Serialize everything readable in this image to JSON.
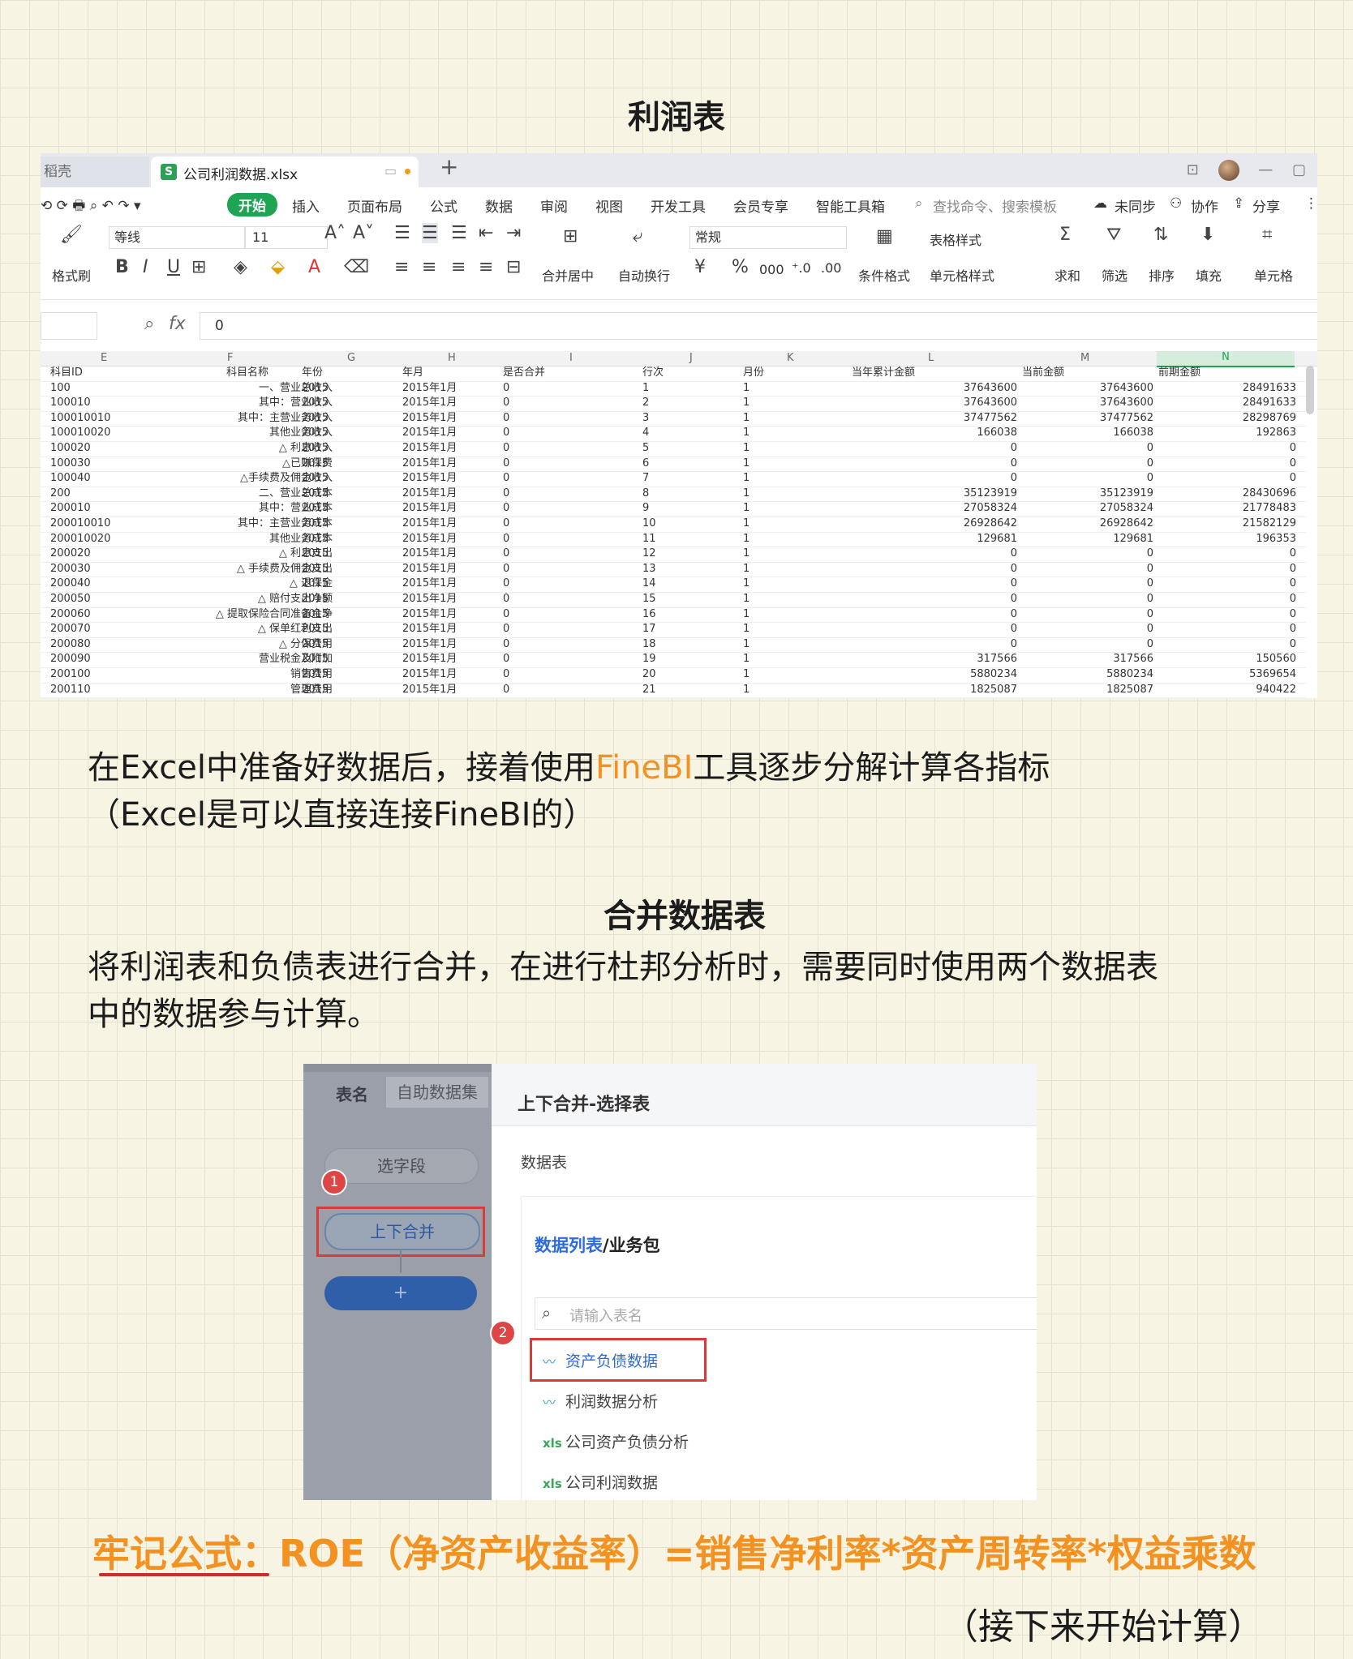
{
  "title1": "利润表",
  "excel": {
    "tab_inactive": "稻壳",
    "tab_file_icon": "S",
    "tab_active": "公司利润数据.xlsx",
    "tab_plus": "+",
    "menu": {
      "start": "开始",
      "items": [
        "插入",
        "页面布局",
        "公式",
        "数据",
        "审阅",
        "视图",
        "开发工具",
        "会员专享",
        "智能工具箱"
      ],
      "search": "查找命令、搜索模板",
      "unsync": "未同步",
      "collab": "协作",
      "share": "分享"
    },
    "ribbon": {
      "format_painter": "格式刷",
      "font_name": "等线",
      "font_size": "11",
      "merge_center": "合并居中",
      "wrap_text": "自动换行",
      "number_format": "常规",
      "cond_format": "条件格式",
      "table_style": "表格样式",
      "cell_style": "单元格样式",
      "sum": "求和",
      "filter": "筛选",
      "sort": "排序",
      "fill": "填充",
      "cell": "单元格"
    },
    "formula_bar": {
      "fx": "fx",
      "value": "0"
    },
    "col_letters": [
      "E",
      "F",
      "G",
      "H",
      "I",
      "J",
      "K",
      "L",
      "M",
      "N"
    ],
    "table": {
      "headers": [
        "科目ID",
        "科目名称",
        "年份",
        "年月",
        "是否合并",
        "行次",
        "月份",
        "当年累计金额",
        "当前金额",
        "前期金额"
      ],
      "rows": [
        [
          "100",
          "一、营业总收入",
          "2015",
          "2015年1月",
          "0",
          "1",
          "1",
          "37643600",
          "37643600",
          "28491633"
        ],
        [
          "100010",
          "其中：营业收入",
          "2015",
          "2015年1月",
          "0",
          "2",
          "1",
          "37643600",
          "37643600",
          "28491633"
        ],
        [
          "100010010",
          "其中：主营业务收入",
          "2015",
          "2015年1月",
          "0",
          "3",
          "1",
          "37477562",
          "37477562",
          "28298769"
        ],
        [
          "100010020",
          "其他业务收入",
          "2015",
          "2015年1月",
          "0",
          "4",
          "1",
          "166038",
          "166038",
          "192863"
        ],
        [
          "100020",
          "△ 利息收入",
          "2015",
          "2015年1月",
          "0",
          "5",
          "1",
          "0",
          "0",
          "0"
        ],
        [
          "100030",
          "△已赚保费",
          "2015",
          "2015年1月",
          "0",
          "6",
          "1",
          "0",
          "0",
          "0"
        ],
        [
          "100040",
          "△手续费及佣金收入",
          "2015",
          "2015年1月",
          "0",
          "7",
          "1",
          "0",
          "0",
          "0"
        ],
        [
          "200",
          "二、营业总成本",
          "2015",
          "2015年1月",
          "0",
          "8",
          "1",
          "35123919",
          "35123919",
          "28430696"
        ],
        [
          "200010",
          "其中：营业成本",
          "2015",
          "2015年1月",
          "0",
          "9",
          "1",
          "27058324",
          "27058324",
          "21778483"
        ],
        [
          "200010010",
          "其中：主营业务成本",
          "2015",
          "2015年1月",
          "0",
          "10",
          "1",
          "26928642",
          "26928642",
          "21582129"
        ],
        [
          "200010020",
          "其他业务成本",
          "2015",
          "2015年1月",
          "0",
          "11",
          "1",
          "129681",
          "129681",
          "196353"
        ],
        [
          "200020",
          "△ 利息支出",
          "2015",
          "2015年1月",
          "0",
          "12",
          "1",
          "0",
          "0",
          "0"
        ],
        [
          "200030",
          "△ 手续费及佣金支出",
          "2015",
          "2015年1月",
          "0",
          "13",
          "1",
          "0",
          "0",
          "0"
        ],
        [
          "200040",
          "△ 退保金",
          "2015",
          "2015年1月",
          "0",
          "14",
          "1",
          "0",
          "0",
          "0"
        ],
        [
          "200050",
          "△ 赔付支出净额",
          "2015",
          "2015年1月",
          "0",
          "15",
          "1",
          "0",
          "0",
          "0"
        ],
        [
          "200060",
          "△ 提取保险合同准备金净",
          "2015",
          "2015年1月",
          "0",
          "16",
          "1",
          "0",
          "0",
          "0"
        ],
        [
          "200070",
          "△ 保单红利支出",
          "2015",
          "2015年1月",
          "0",
          "17",
          "1",
          "0",
          "0",
          "0"
        ],
        [
          "200080",
          "△ 分保费用",
          "2015",
          "2015年1月",
          "0",
          "18",
          "1",
          "0",
          "0",
          "0"
        ],
        [
          "200090",
          "营业税金及附加",
          "2015",
          "2015年1月",
          "0",
          "19",
          "1",
          "317566",
          "317566",
          "150560"
        ],
        [
          "200100",
          "销售费用",
          "2015",
          "2015年1月",
          "0",
          "20",
          "1",
          "5880234",
          "5880234",
          "5369654"
        ],
        [
          "200110",
          "管理费用",
          "2015",
          "2015年1月",
          "0",
          "21",
          "1",
          "1825087",
          "1825087",
          "940422"
        ]
      ]
    }
  },
  "para1": {
    "before": "在Excel中准备好数据后，接着使用",
    "highlight": "FineBI",
    "after": "工具逐步分解计算各指标"
  },
  "para2": "（Excel是可以直接连接FineBI的）",
  "title2": "合并数据表",
  "para3": "将利润表和负债表进行合并，在进行杜邦分析时，需要同时使用两个数据表",
  "para4": "中的数据参与计算。",
  "bi": {
    "tab_name": "表名",
    "tab_dataset": "自助数据集",
    "select_field": "选字段",
    "merge_updown": "上下合并",
    "add": "+",
    "badge1": "1",
    "badge2": "2",
    "panel_title": "上下合并-选择表",
    "data_table_label": "数据表",
    "breadcrumb_link": "数据列表",
    "breadcrumb_rest": "/业务包",
    "search_placeholder": "请输入表名",
    "items": [
      {
        "icon": "chart",
        "label": "资产负债数据"
      },
      {
        "icon": "chart",
        "label": "利润数据分析"
      },
      {
        "icon": "xls",
        "label": "公司资产负债分析"
      },
      {
        "icon": "xls",
        "label": "公司利润数据"
      }
    ]
  },
  "formula": "牢记公式：ROE（净资产收益率）=销售净利率*资产周转率*权益乘数",
  "closing": "（接下来开始计算）"
}
